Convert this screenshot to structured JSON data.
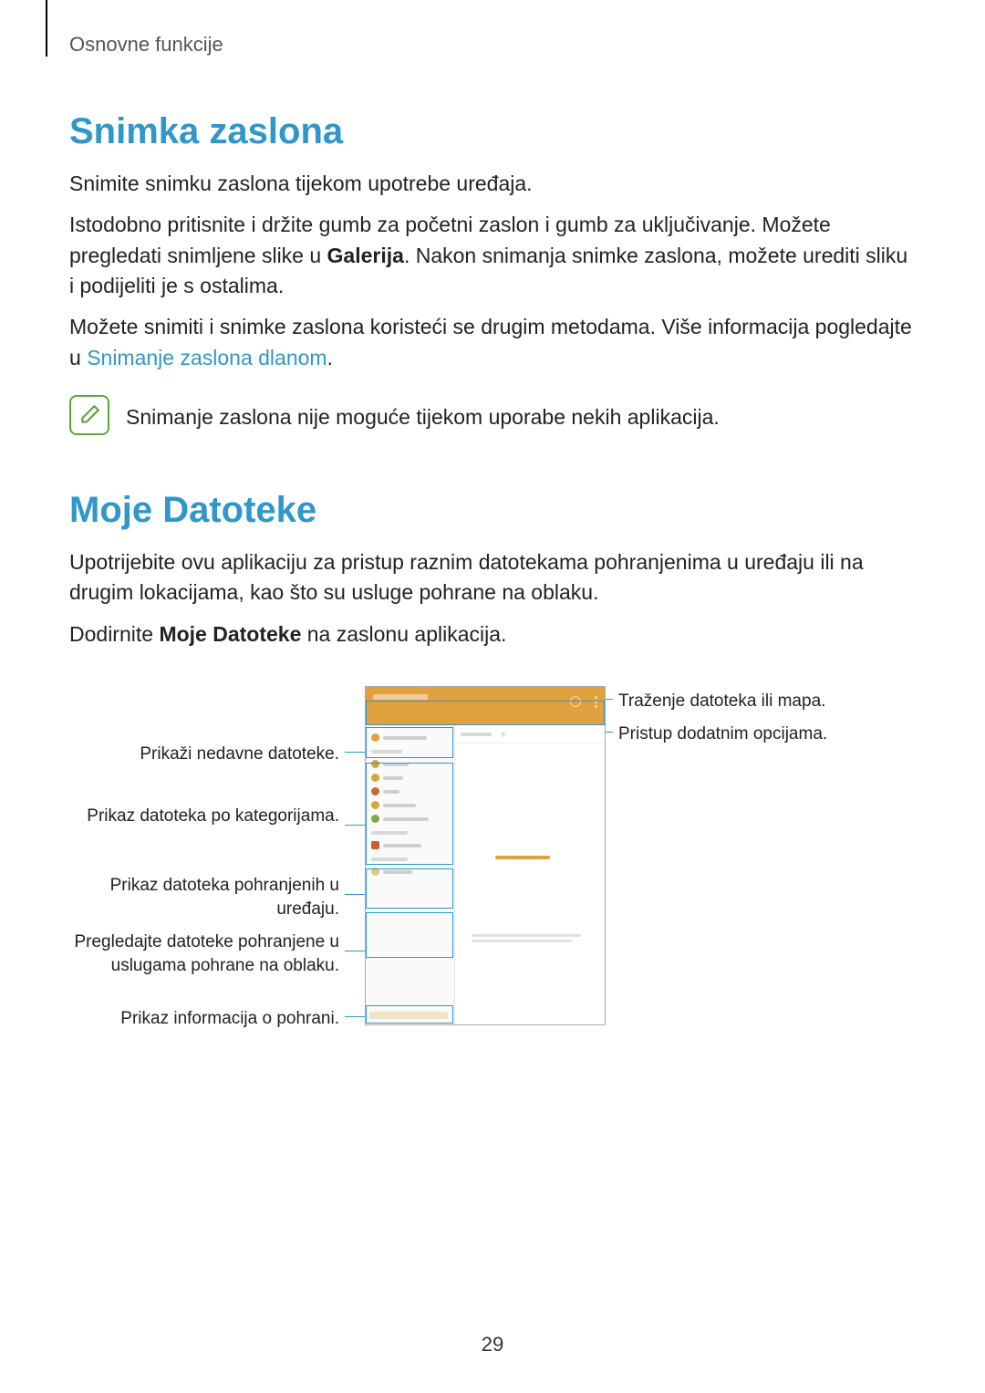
{
  "breadcrumb": "Osnovne funkcije",
  "section1": {
    "title": "Snimka zaslona",
    "p1": "Snimite snimku zaslona tijekom upotrebe uređaja.",
    "p2a": "Istodobno pritisnite i držite gumb za početni zaslon i gumb za uključivanje. Možete pregledati snimljene slike u ",
    "p2bold": "Galerija",
    "p2b": ". Nakon snimanja snimke zaslona, možete urediti sliku i podijeliti je s ostalima.",
    "p3a": "Možete snimiti i snimke zaslona koristeći se drugim metodama. Više informacija pogledajte u ",
    "p3link": "Snimanje zaslona dlanom",
    "p3b": ".",
    "note": "Snimanje zaslona nije moguće tijekom uporabe nekih aplikacija."
  },
  "section2": {
    "title": "Moje Datoteke",
    "p1": "Upotrijebite ovu aplikaciju za pristup raznim datotekama pohranjenima u uređaju ili na drugim lokacijama, kao što su usluge pohrane na oblaku.",
    "p2a": "Dodirnite ",
    "p2bold": "Moje Datoteke",
    "p2b": " na zaslonu aplikacija."
  },
  "callouts": {
    "left1": "Prikaži nedavne datoteke.",
    "left2": "Prikaz datoteka po kategorijama.",
    "left3": "Prikaz datoteka pohranjenih u uređaju.",
    "left4": "Pregledajte datoteke pohranjene u uslugama pohrane na oblaku.",
    "left5": "Prikaz informacija o pohrani.",
    "right1": "Traženje datoteka ili mapa.",
    "right2": "Pristup dodatnim opcijama."
  },
  "page_number": "29"
}
